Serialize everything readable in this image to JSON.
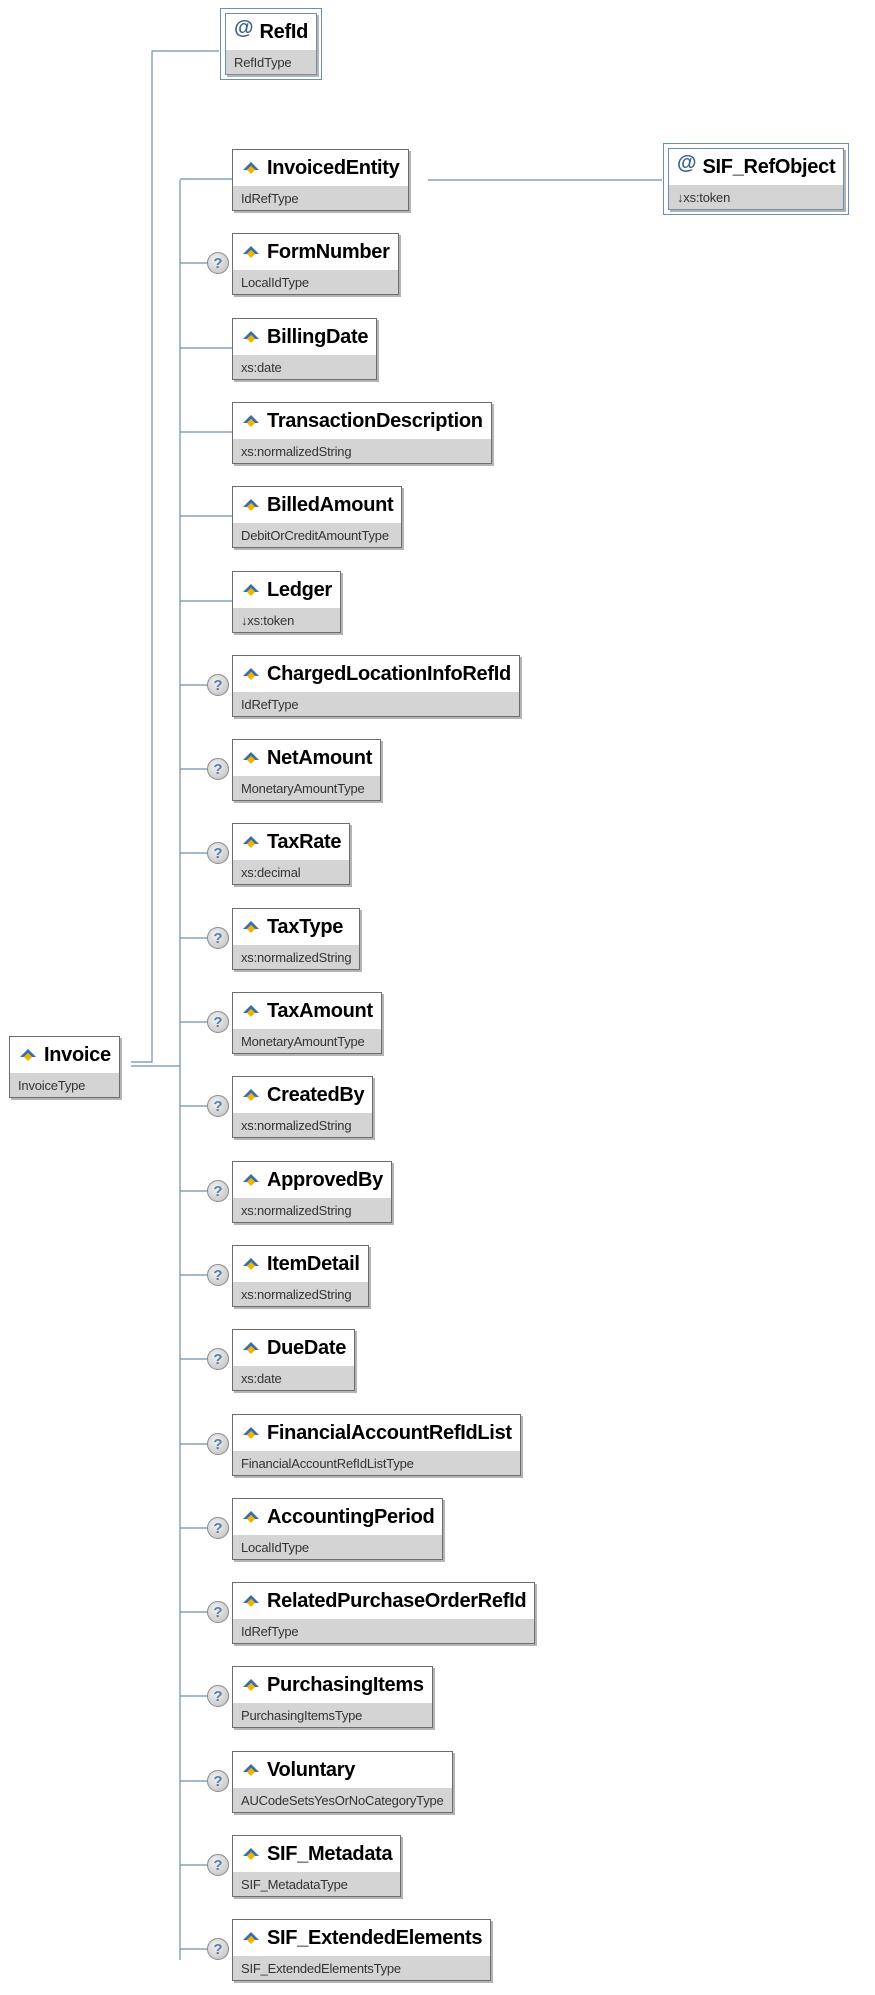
{
  "root": {
    "name": "Invoice",
    "type": "InvoiceType"
  },
  "attribute": {
    "name": "RefId",
    "type": "RefIdType"
  },
  "ref_object": {
    "name": "SIF_RefObject",
    "type": "↓xs:token"
  },
  "optional_marker": "?",
  "elements": [
    {
      "name": "InvoicedEntity",
      "type": "IdRefType",
      "optional": false
    },
    {
      "name": "FormNumber",
      "type": "LocalIdType",
      "optional": true
    },
    {
      "name": "BillingDate",
      "type": "xs:date",
      "optional": false
    },
    {
      "name": "TransactionDescription",
      "type": "xs:normalizedString",
      "optional": false
    },
    {
      "name": "BilledAmount",
      "type": "DebitOrCreditAmountType",
      "optional": false
    },
    {
      "name": "Ledger",
      "type": "↓xs:token",
      "optional": false
    },
    {
      "name": "ChargedLocationInfoRefId",
      "type": "IdRefType",
      "optional": true
    },
    {
      "name": "NetAmount",
      "type": "MonetaryAmountType",
      "optional": true
    },
    {
      "name": "TaxRate",
      "type": "xs:decimal",
      "optional": true
    },
    {
      "name": "TaxType",
      "type": "xs:normalizedString",
      "optional": true
    },
    {
      "name": "TaxAmount",
      "type": "MonetaryAmountType",
      "optional": true
    },
    {
      "name": "CreatedBy",
      "type": "xs:normalizedString",
      "optional": true
    },
    {
      "name": "ApprovedBy",
      "type": "xs:normalizedString",
      "optional": true
    },
    {
      "name": "ItemDetail",
      "type": "xs:normalizedString",
      "optional": true
    },
    {
      "name": "DueDate",
      "type": "xs:date",
      "optional": true
    },
    {
      "name": "FinancialAccountRefIdList",
      "type": "FinancialAccountRefIdListType",
      "optional": true
    },
    {
      "name": "AccountingPeriod",
      "type": "LocalIdType",
      "optional": true
    },
    {
      "name": "RelatedPurchaseOrderRefId",
      "type": "IdRefType",
      "optional": true
    },
    {
      "name": "PurchasingItems",
      "type": "PurchasingItemsType",
      "optional": true
    },
    {
      "name": "Voluntary",
      "type": "AUCodeSetsYesOrNoCategoryType",
      "optional": true
    },
    {
      "name": "SIF_Metadata",
      "type": "SIF_MetadataType",
      "optional": true
    },
    {
      "name": "SIF_ExtendedElements",
      "type": "SIF_ExtendedElementsType",
      "optional": true
    }
  ]
}
